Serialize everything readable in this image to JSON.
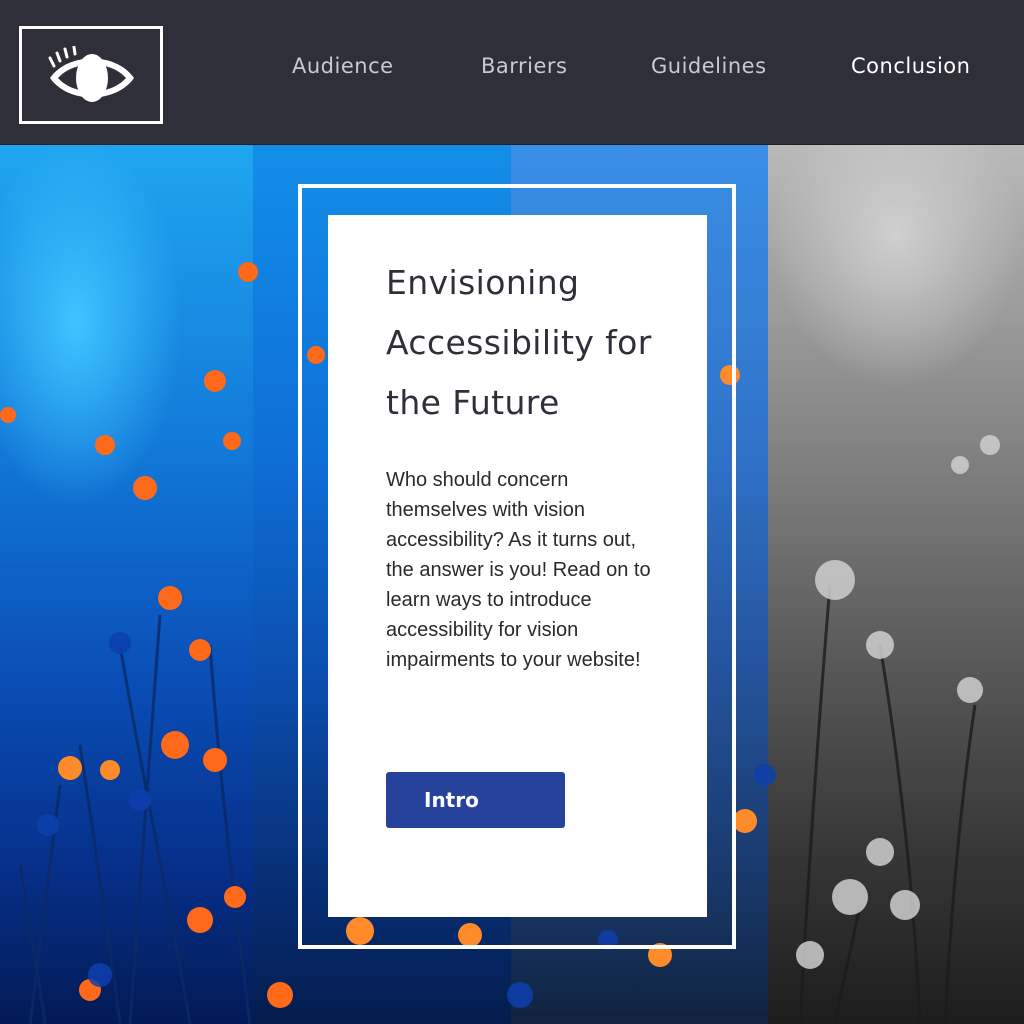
{
  "logo": {
    "icon": "eye-icon"
  },
  "nav": {
    "items": [
      {
        "label": "Audience"
      },
      {
        "label": "Barriers"
      },
      {
        "label": "Guidelines"
      },
      {
        "label": "Conclusion"
      }
    ]
  },
  "card": {
    "title": "Envisioning Accessibility for the Future",
    "body": "Who should concern themselves with vision accessibility? As it turns out, the answer is you! Read on to learn ways to introduce accessibility for vision impairments to your website!",
    "button_label": "Intro"
  },
  "colors": {
    "header_bg": "#2f2f3a",
    "button_bg": "#26429b",
    "card_bg": "#ffffff"
  }
}
